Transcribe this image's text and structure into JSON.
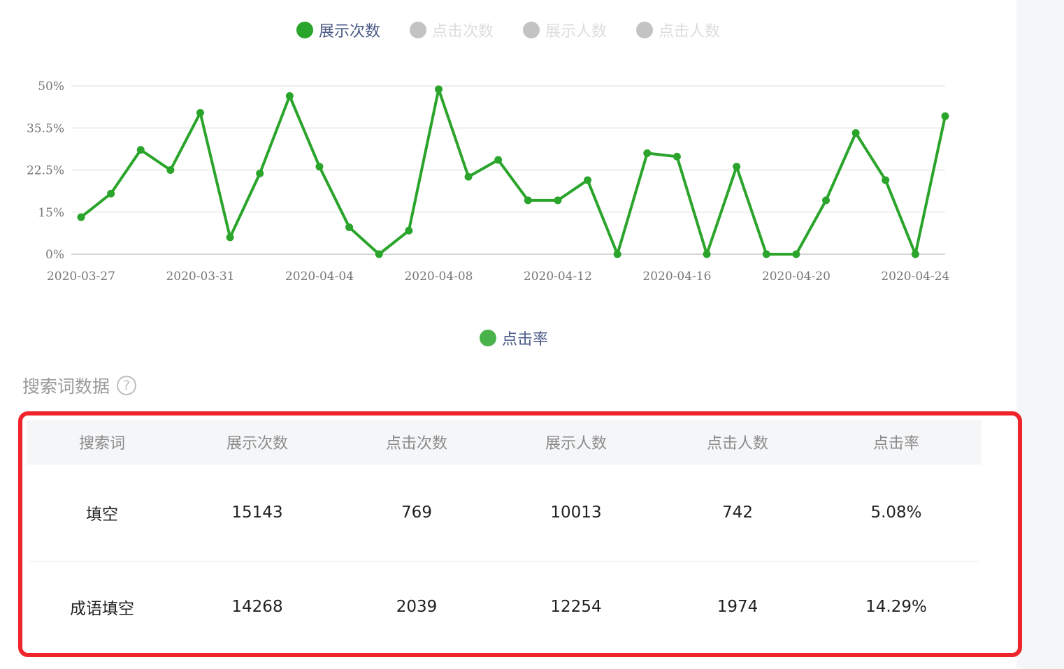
{
  "legend_top": [
    {
      "label": "展示次数",
      "active": true
    },
    {
      "label": "点击次数",
      "active": false
    },
    {
      "label": "展示人数",
      "active": false
    },
    {
      "label": "点击人数",
      "active": false
    }
  ],
  "legend_bottom": {
    "label": "点击率"
  },
  "section_title": "搜索词数据",
  "help_glyph": "?",
  "colors": {
    "line": "#2aa42a",
    "legend_active": "#2aa42a",
    "legend_inactive": "#c3c3c3",
    "frame": "#f0242b"
  },
  "chart_data": {
    "type": "line",
    "y_ticks": [
      "50%",
      "35.5%",
      "22.5%",
      "15%",
      "0%"
    ],
    "x_ticks": [
      "2020-03-27",
      "2020-03-31",
      "2020-04-04",
      "2020-04-08",
      "2020-04-12",
      "2020-04-16",
      "2020-04-20",
      "2020-04-24"
    ],
    "ylim": [
      0,
      50
    ],
    "grid": true,
    "series": [
      {
        "dates": [
          "2020-03-27",
          "2020-03-28",
          "2020-03-29",
          "2020-03-30",
          "2020-03-31",
          "2020-04-01",
          "2020-04-02",
          "2020-04-03",
          "2020-04-04",
          "2020-04-05",
          "2020-04-06",
          "2020-04-07",
          "2020-04-08",
          "2020-04-09",
          "2020-04-10",
          "2020-04-11",
          "2020-04-12",
          "2020-04-13",
          "2020-04-14",
          "2020-04-15",
          "2020-04-16",
          "2020-04-17",
          "2020-04-18",
          "2020-04-19",
          "2020-04-20",
          "2020-04-21",
          "2020-04-22",
          "2020-04-23",
          "2020-04-24",
          "2020-04-25"
        ],
        "values": [
          11,
          18,
          31,
          25,
          42,
          5,
          24,
          47,
          26,
          8,
          0,
          7,
          49,
          23,
          28,
          16,
          16,
          22,
          0,
          30,
          29,
          0,
          26,
          0,
          0,
          16,
          36,
          22,
          0,
          41
        ]
      }
    ]
  },
  "table": {
    "headers": [
      "搜索词",
      "展示次数",
      "点击次数",
      "展示人数",
      "点击人数",
      "点击率"
    ],
    "rows": [
      [
        "填空",
        "15143",
        "769",
        "10013",
        "742",
        "5.08%"
      ],
      [
        "成语填空",
        "14268",
        "2039",
        "12254",
        "1974",
        "14.29%"
      ]
    ]
  }
}
